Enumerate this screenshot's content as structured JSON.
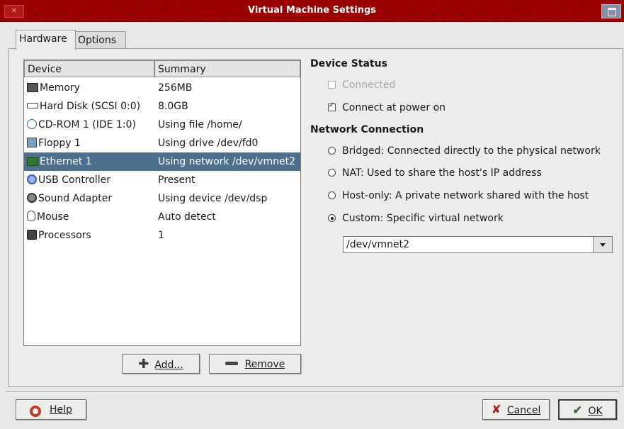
{
  "window": {
    "title": "Virtual Machine Settings"
  },
  "tabs": [
    {
      "label": "Hardware"
    },
    {
      "label": "Options"
    }
  ],
  "device_list": {
    "columns": [
      "Device",
      "Summary"
    ],
    "rows": [
      {
        "icon": "memory-icon",
        "device": "Memory",
        "summary": "256MB"
      },
      {
        "icon": "hard-disk-icon",
        "device": "Hard Disk (SCSI 0:0)",
        "summary": "8.0GB"
      },
      {
        "icon": "cdrom-icon",
        "device": "CD-ROM 1 (IDE 1:0)",
        "summary": "Using file /home/"
      },
      {
        "icon": "floppy-icon",
        "device": "Floppy 1",
        "summary": "Using drive /dev/fd0"
      },
      {
        "icon": "ethernet-icon",
        "device": "Ethernet 1",
        "summary": "Using network /dev/vmnet2"
      },
      {
        "icon": "usb-icon",
        "device": "USB Controller",
        "summary": "Present"
      },
      {
        "icon": "sound-icon",
        "device": "Sound Adapter",
        "summary": "Using device /dev/dsp"
      },
      {
        "icon": "mouse-icon",
        "device": "Mouse",
        "summary": "Auto detect"
      },
      {
        "icon": "processor-icon",
        "device": "Processors",
        "summary": "1"
      }
    ],
    "selected_row": "Ethernet 1"
  },
  "list_buttons": {
    "add": "Add...",
    "remove": "Remove"
  },
  "device_status": {
    "title": "Device Status",
    "connected": {
      "label": "Connected",
      "checked": false,
      "enabled": false
    },
    "connect_at_power_on": {
      "label": "Connect at power on",
      "checked": true,
      "enabled": true
    }
  },
  "network_connection": {
    "title": "Network Connection",
    "options": [
      {
        "label": "Bridged: Connected directly to the physical network",
        "selected": false
      },
      {
        "label": "NAT: Used to share the host's IP address",
        "selected": false
      },
      {
        "label": "Host-only: A private network shared with the host",
        "selected": false
      },
      {
        "label": "Custom: Specific virtual network",
        "selected": true
      }
    ],
    "custom_network_value": "/dev/vmnet2"
  },
  "footer_buttons": {
    "help": "Help",
    "cancel": "Cancel",
    "ok": "OK"
  }
}
